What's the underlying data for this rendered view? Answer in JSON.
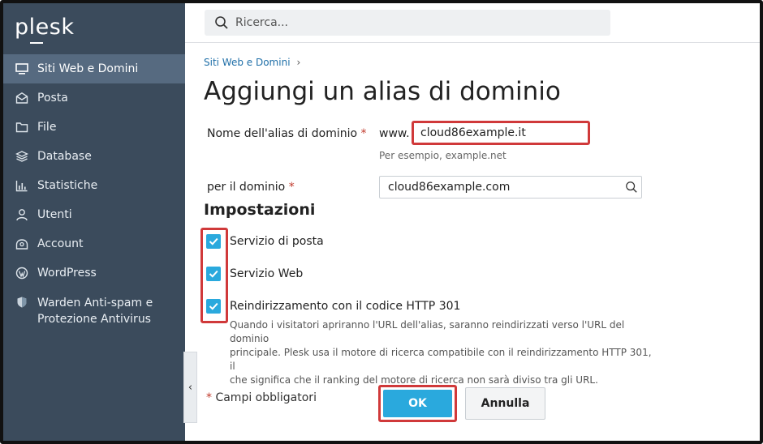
{
  "app": {
    "logo": "plesk"
  },
  "search": {
    "placeholder": "Ricerca..."
  },
  "sidebar": {
    "items": [
      {
        "label": "Siti Web e Domini",
        "icon": "monitor-icon",
        "active": true
      },
      {
        "label": "Posta",
        "icon": "mail-icon"
      },
      {
        "label": "File",
        "icon": "folder-icon"
      },
      {
        "label": "Database",
        "icon": "database-icon"
      },
      {
        "label": "Statistiche",
        "icon": "bar-chart-icon"
      },
      {
        "label": "Utenti",
        "icon": "user-icon"
      },
      {
        "label": "Account",
        "icon": "account-icon"
      },
      {
        "label": "WordPress",
        "icon": "wordpress-icon"
      },
      {
        "label_line1": "Warden Anti-spam e",
        "label_line2": "Protezione Antivirus",
        "icon": "shield-icon"
      }
    ],
    "collapse_glyph": "‹"
  },
  "breadcrumb": {
    "item": "Siti Web e Domini",
    "separator": "›"
  },
  "page": {
    "title": "Aggiungi un alias di dominio"
  },
  "form": {
    "alias_label": "Nome dell'alias di dominio",
    "required_mark": "*",
    "alias_prefix": "www.",
    "alias_value": "cloud86example.it",
    "alias_hint": "Per esempio, example.net",
    "domain_label": "per il dominio",
    "domain_value": "cloud86example.com",
    "settings_title": "Impostazioni",
    "options": [
      {
        "label": "Servizio di posta",
        "checked": true
      },
      {
        "label": "Servizio Web",
        "checked": true
      },
      {
        "label": "Reindirizzamento con il codice HTTP 301",
        "checked": true
      }
    ],
    "redirect_desc_1": "Quando i visitatori apriranno l'URL dell'alias, saranno reindirizzati verso l'URL del dominio",
    "redirect_desc_2": "principale. Plesk usa il motore di ricerca compatibile con il reindirizzamento HTTP 301, il",
    "redirect_desc_3": "che significa che il ranking del motore di ricerca non sarà diviso tra gli URL.",
    "required_note": "Campi obbligatori",
    "ok_label": "OK",
    "cancel_label": "Annulla"
  },
  "colors": {
    "sidebar_bg": "#3b4b5c",
    "accent": "#2aa9dd",
    "highlight": "#d0393a"
  }
}
